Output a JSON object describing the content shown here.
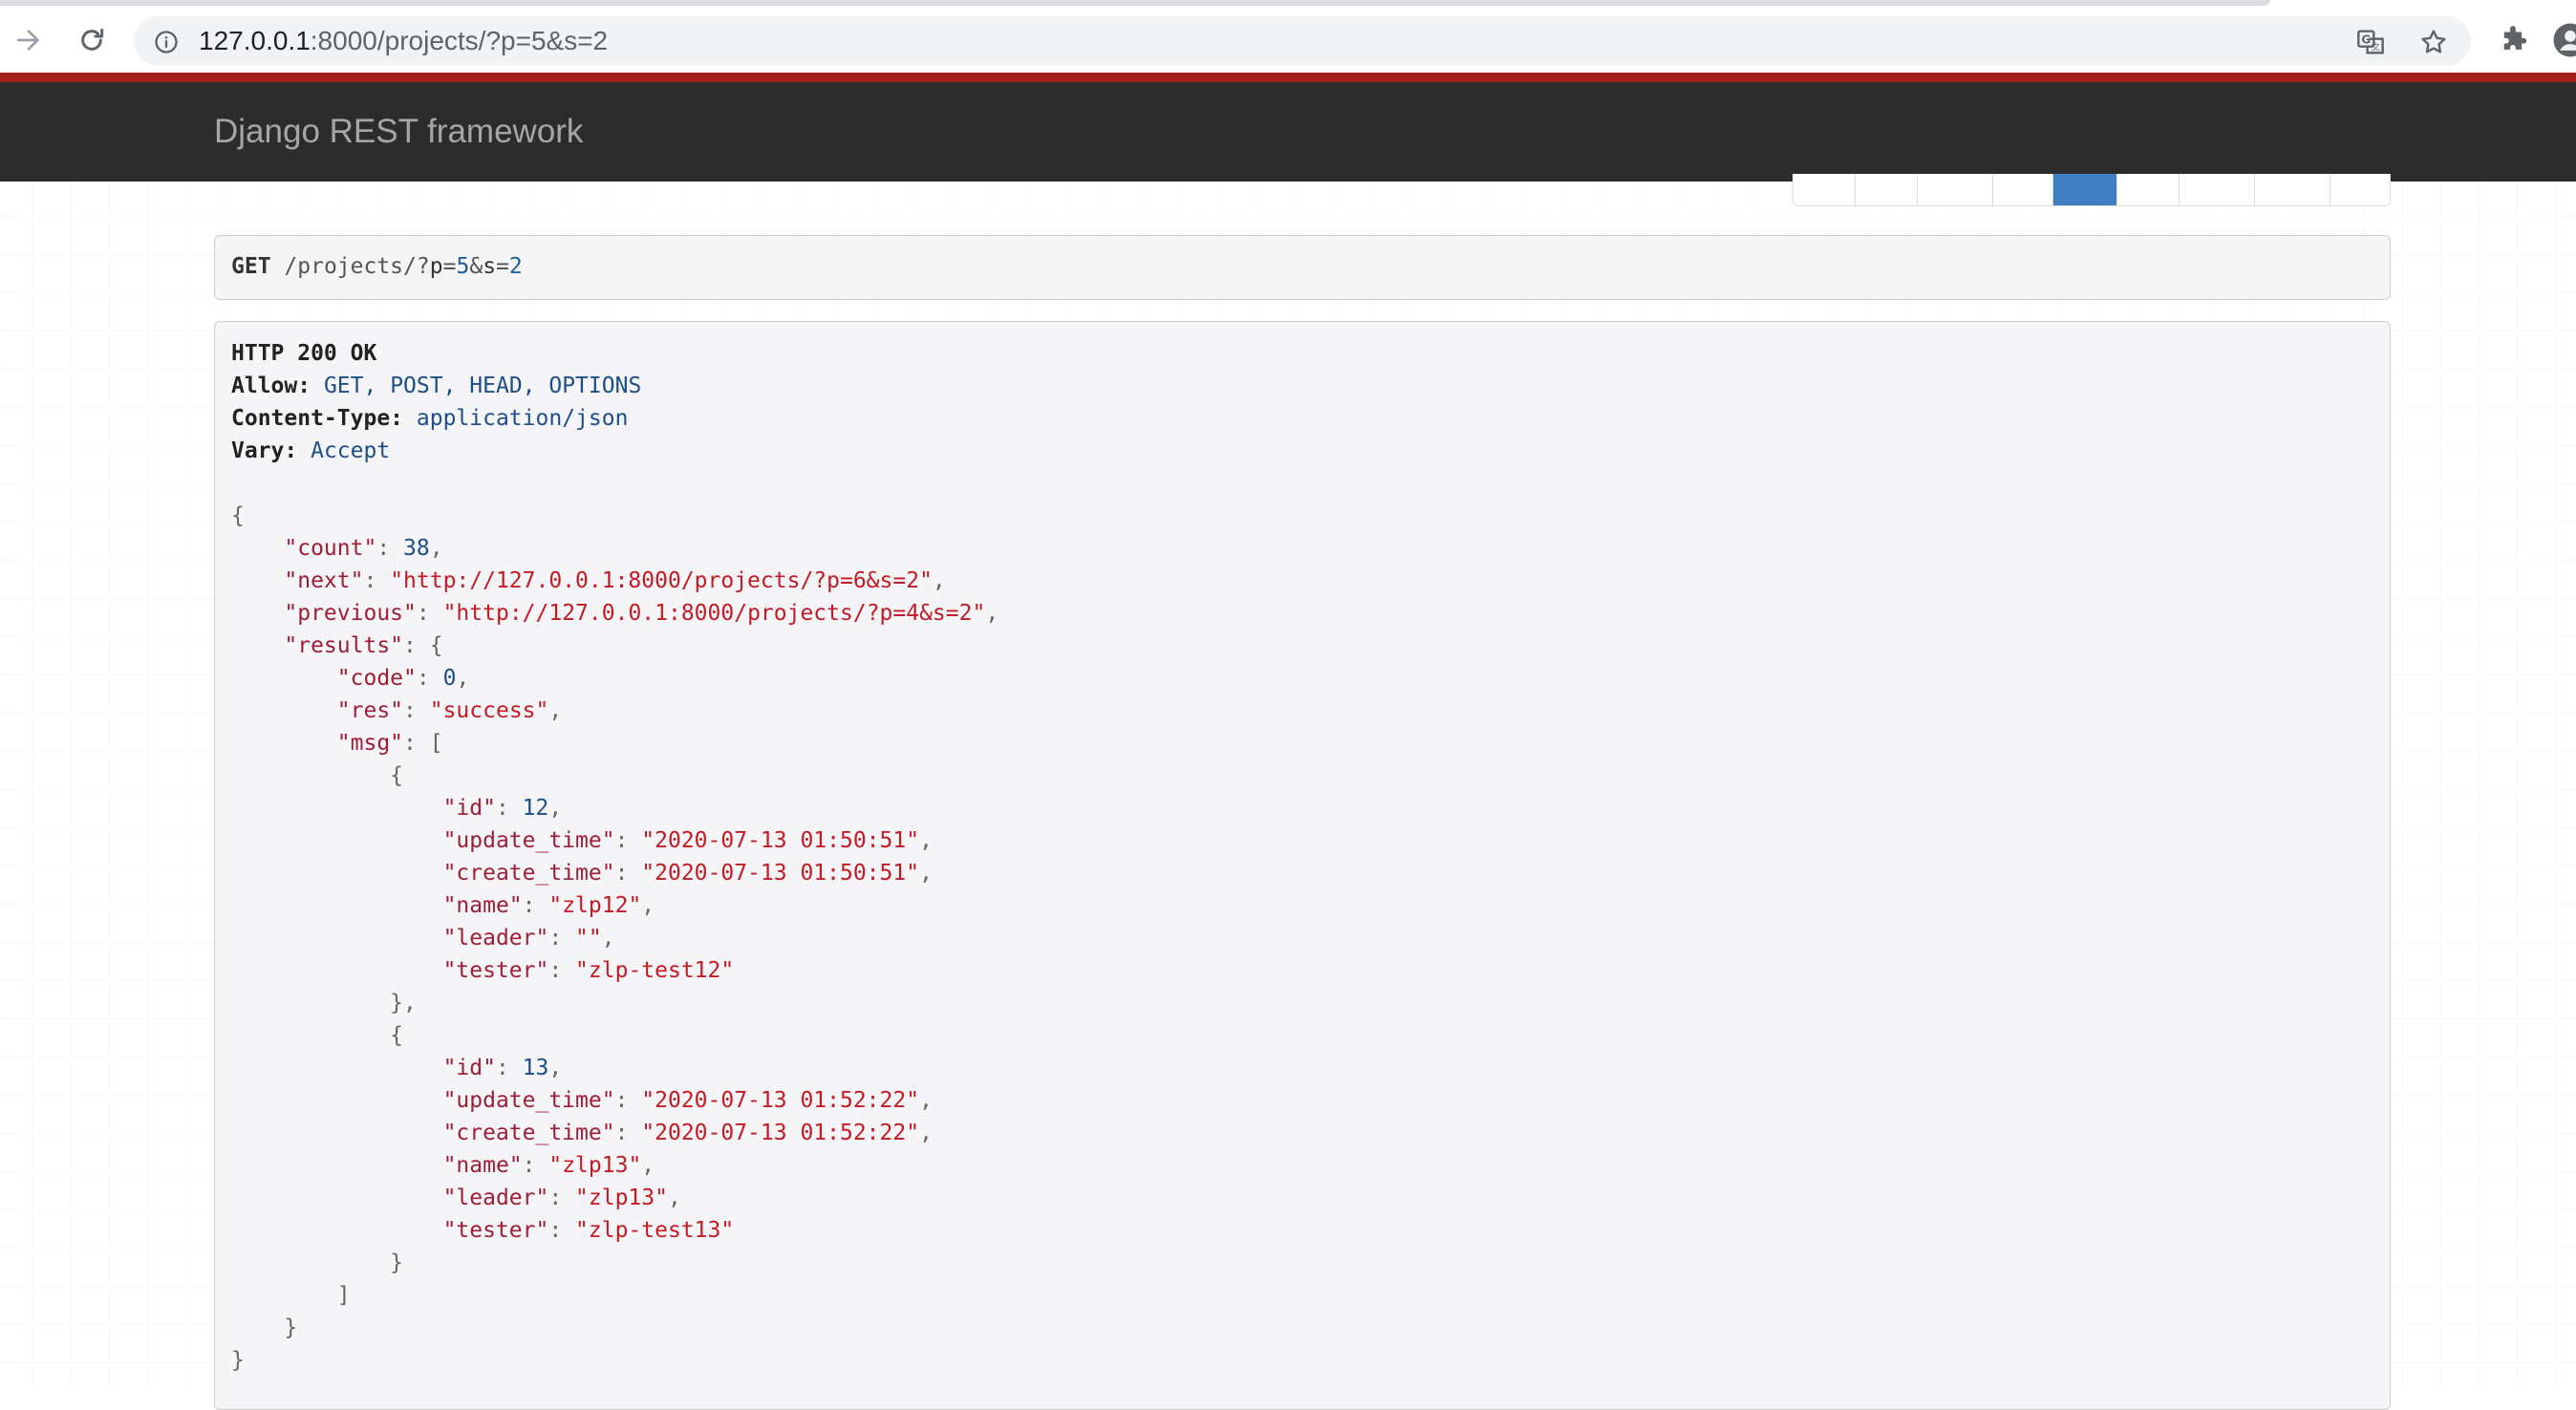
{
  "browser": {
    "url_host": "127.0.0.1",
    "url_path": ":8000/projects/?p=5&s=2",
    "icons": [
      "forward-arrow-icon",
      "reload-icon",
      "site-info-icon",
      "translate-icon",
      "bookmark-star-icon",
      "extensions-puzzle-icon",
      "profile-avatar-icon"
    ]
  },
  "navbar": {
    "brand": "Django REST framework"
  },
  "pagination": {
    "active_page_index": 4,
    "colors": {
      "active": "#3f7ec0",
      "link": "#337ab7"
    }
  },
  "request": {
    "method": "GET",
    "path": "/projects/",
    "qmark": "?",
    "p_key": "p",
    "eq1": "=",
    "p_val": "5",
    "amp": "&",
    "s_key": "s",
    "eq2": "=",
    "s_val": "2"
  },
  "response": {
    "status": "HTTP 200 OK",
    "headers": [
      {
        "key": "Allow:",
        "value": "GET, POST, HEAD, OPTIONS"
      },
      {
        "key": "Content-Type:",
        "value": "application/json"
      },
      {
        "key": "Vary:",
        "value": "Accept"
      }
    ],
    "body": {
      "count": "38",
      "next": "\"http://127.0.0.1:8000/projects/?p=6&s=2\"",
      "previous": "\"http://127.0.0.1:8000/projects/?p=4&s=2\"",
      "results": {
        "code": "0",
        "res": "\"success\"",
        "msg": [
          {
            "id": "12",
            "update_time": "\"2020-07-13 01:50:51\"",
            "create_time": "\"2020-07-13 01:50:51\"",
            "name": "\"zlp12\"",
            "leader": "\"\"",
            "tester": "\"zlp-test12\""
          },
          {
            "id": "13",
            "update_time": "\"2020-07-13 01:52:22\"",
            "create_time": "\"2020-07-13 01:52:22\"",
            "name": "\"zlp13\"",
            "leader": "\"zlp13\"",
            "tester": "\"zlp-test13\""
          }
        ]
      }
    },
    "keys": {
      "count": "\"count\"",
      "next": "\"next\"",
      "previous": "\"previous\"",
      "results": "\"results\"",
      "code": "\"code\"",
      "res": "\"res\"",
      "msg": "\"msg\"",
      "id": "\"id\"",
      "update_time": "\"update_time\"",
      "create_time": "\"create_time\"",
      "name": "\"name\"",
      "leader": "\"leader\"",
      "tester": "\"tester\""
    }
  }
}
